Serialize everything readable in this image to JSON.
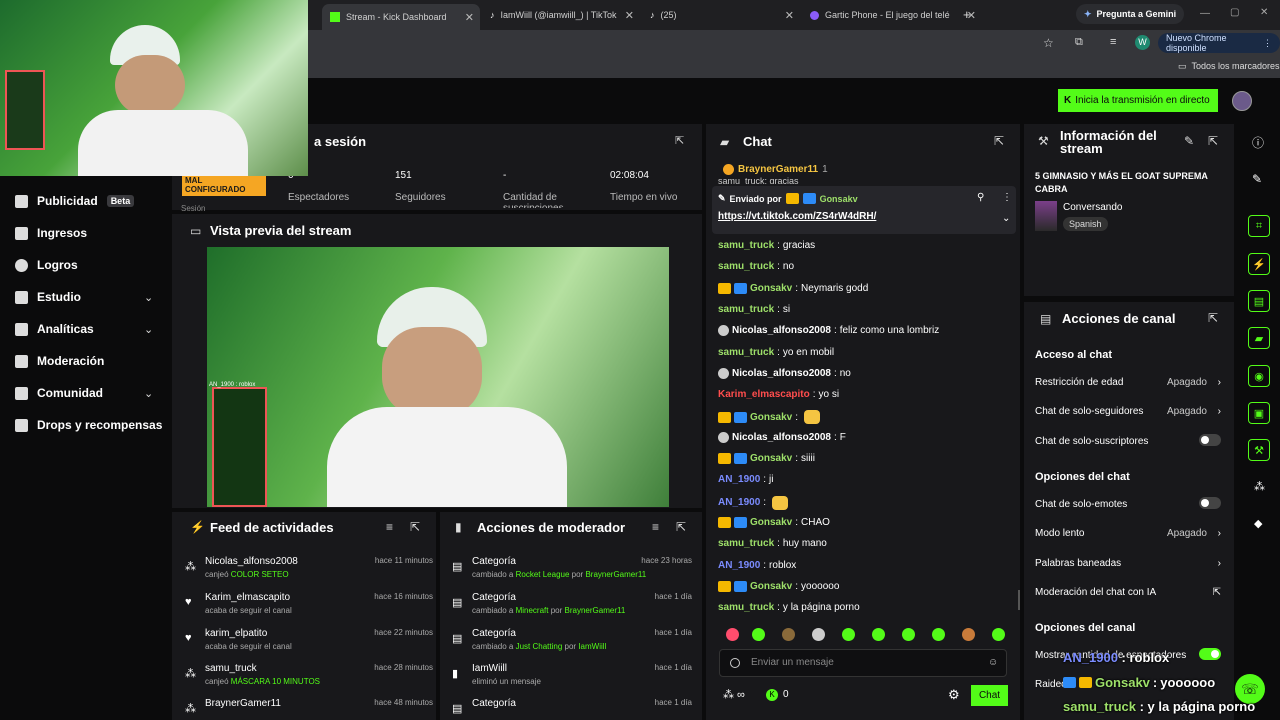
{
  "browser": {
    "tabs": [
      {
        "label": "Stream - Kick Dashboard"
      },
      {
        "label": "IamWiill (@iamwiill_) | TikTok"
      },
      {
        "label": "(25)"
      },
      {
        "label": "Gartic Phone - El juego del telé"
      }
    ],
    "gemini": "Pregunta a Gemini",
    "new_chrome": "Nuevo Chrome disponible",
    "bookmarks": "Todos los marcadores",
    "avatar_letter": "W"
  },
  "header": {
    "go_live": "Inicia la transmisión en directo"
  },
  "sidebar": {
    "items": [
      {
        "label": "Publicidad",
        "badge": "Beta"
      },
      {
        "label": "Ingresos"
      },
      {
        "label": "Logros"
      },
      {
        "label": "Estudio"
      },
      {
        "label": "Analíticas"
      },
      {
        "label": "Moderación"
      },
      {
        "label": "Comunidad"
      },
      {
        "label": "Drops y recompensas"
      }
    ]
  },
  "session": {
    "title": "a sesión",
    "warning": "MAL CONFIGURADO",
    "stats": [
      {
        "value": "0",
        "label": "Espectadores"
      },
      {
        "value": "151",
        "label": "Seguidores"
      },
      {
        "value": "-",
        "label": "Cantidad de suscripciones"
      },
      {
        "value": "02:08:04",
        "label": "Tiempo en vivo"
      }
    ],
    "cut_label": "Sesión"
  },
  "preview": {
    "title": "Vista previa del stream",
    "overlay": "AN_1900 : roblox"
  },
  "feed": {
    "title": "Feed de actividades",
    "items": [
      {
        "name": "Nicolas_alfonso2008",
        "pre": "canjeó ",
        "hl": "COLOR SETEO",
        "post": "",
        "time": "hace 11 minutos"
      },
      {
        "name": "Karim_elmascapito",
        "pre": "acaba de seguir el canal",
        "hl": "",
        "post": "",
        "time": "hace 16 minutos"
      },
      {
        "name": "karim_elpatito",
        "pre": "acaba de seguir el canal",
        "hl": "",
        "post": "",
        "time": "hace 22 minutos"
      },
      {
        "name": "samu_truck",
        "pre": "canjeó ",
        "hl": "MÁSCARA 10 MINUTOS",
        "post": "",
        "time": "hace 28 minutos"
      },
      {
        "name": "BraynerGamer11",
        "pre": "",
        "hl": "",
        "post": "",
        "time": "hace 48 minutos"
      }
    ]
  },
  "modactions": {
    "title": "Acciones de moderador",
    "items": [
      {
        "name": "Categoría",
        "pre": "cambiado a ",
        "cat": "Rocket League",
        "mid": " por ",
        "user": "BraynerGamer11",
        "time": "hace 23 horas"
      },
      {
        "name": "Categoría",
        "pre": "cambiado a ",
        "cat": "Minecraft",
        "mid": " por ",
        "user": "BraynerGamer11",
        "time": "hace 1 día"
      },
      {
        "name": "Categoría",
        "pre": "cambiado a ",
        "cat": "Just Chatting",
        "mid": " por ",
        "user": "IamWiill",
        "time": "hace 1 día"
      },
      {
        "name": "IamWiill",
        "pre": "eliminó un mensaje",
        "cat": "",
        "mid": "",
        "user": "",
        "time": "hace 1 día"
      },
      {
        "name": "Categoría",
        "pre": "",
        "cat": "",
        "mid": "",
        "user": "",
        "time": "hace 1 día"
      }
    ]
  },
  "chat": {
    "title": "Chat",
    "top_user": "BraynerGamer11",
    "top_count": "1",
    "top_cut": "samu_truck: gracias",
    "pinned_by_label": "Enviado por",
    "pinned_by": "Gonsakv",
    "pinned_link": "https://vt.tiktok.com/ZS4rW4dRH/",
    "messages": [
      {
        "user": "samu_truck",
        "text": "gracias",
        "color": "#9ee06a",
        "badges": ""
      },
      {
        "user": "samu_truck",
        "text": "no",
        "color": "#9ee06a",
        "badges": ""
      },
      {
        "user": "Gonsakv",
        "text": "Neymaris godd",
        "color": "#9ee06a",
        "badges": "cb"
      },
      {
        "user": "samu_truck",
        "text": "si",
        "color": "#9ee06a",
        "badges": ""
      },
      {
        "user": "Nicolas_alfonso2008",
        "text": "feliz como una lombriz",
        "color": "#ffffff",
        "badges": "w"
      },
      {
        "user": "samu_truck",
        "text": "yo en mobil",
        "color": "#9ee06a",
        "badges": ""
      },
      {
        "user": "Nicolas_alfonso2008",
        "text": "no",
        "color": "#ffffff",
        "badges": "w"
      },
      {
        "user": "Karim_elmascapito",
        "text": "yo si",
        "color": "#ff4d4d",
        "badges": ""
      },
      {
        "user": "Gonsakv",
        "text": "",
        "color": "#9ee06a",
        "badges": "cb"
      },
      {
        "user": "Nicolas_alfonso2008",
        "text": "F",
        "color": "#ffffff",
        "badges": "w"
      },
      {
        "user": "Gonsakv",
        "text": "siiii",
        "color": "#9ee06a",
        "badges": "cb"
      },
      {
        "user": "AN_1900",
        "text": "ji",
        "color": "#7b8cff",
        "badges": ""
      },
      {
        "user": "AN_1900",
        "text": "",
        "color": "#7b8cff",
        "badges": ""
      },
      {
        "user": "Gonsakv",
        "text": "CHAO",
        "color": "#9ee06a",
        "badges": "cb"
      },
      {
        "user": "samu_truck",
        "text": "huy mano",
        "color": "#9ee06a",
        "badges": ""
      },
      {
        "user": "AN_1900",
        "text": "roblox",
        "color": "#7b8cff",
        "badges": ""
      },
      {
        "user": "Gonsakv",
        "text": "yoooooo",
        "color": "#9ee06a",
        "badges": "cb"
      },
      {
        "user": "samu_truck",
        "text": "y la página porno",
        "color": "#9ee06a",
        "badges": ""
      }
    ],
    "placeholder": "Enviar un mensaje",
    "count": "0",
    "send": "Chat"
  },
  "info": {
    "title": "Información del stream",
    "stream_title": "5 GIMNASIO Y MÁS EL GOAT SUPREMA CABRA",
    "category": "Conversando",
    "language": "Spanish"
  },
  "channel": {
    "title": "Acciones de canal",
    "sections": [
      {
        "heading": "Acceso al chat",
        "rows": [
          {
            "label": "Restricción de edad",
            "value": "Apagado",
            "kind": "arrow"
          },
          {
            "label": "Chat de solo-seguidores",
            "value": "Apagado",
            "kind": "arrow"
          },
          {
            "label": "Chat de solo-suscriptores",
            "value": "",
            "kind": "toggle"
          }
        ]
      },
      {
        "heading": "Opciones del chat",
        "rows": [
          {
            "label": "Chat de solo-emotes",
            "value": "",
            "kind": "toggle"
          },
          {
            "label": "Modo lento",
            "value": "Apagado",
            "kind": "arrow"
          },
          {
            "label": "Palabras baneadas",
            "value": "",
            "kind": "arrow"
          },
          {
            "label": "Moderación del chat con IA",
            "value": "",
            "kind": "ext"
          }
        ]
      },
      {
        "heading": "Opciones del canal",
        "rows": [
          {
            "label": "Mostrar cantidad de espectadores",
            "value": "",
            "kind": "toggle-on"
          },
          {
            "label": "Raideo",
            "value": "",
            "kind": "none"
          }
        ]
      }
    ]
  },
  "overlay_chat": [
    {
      "user": "AN_1900",
      "text": "roblox"
    },
    {
      "user": "Gonsakv",
      "text": "yoooooo"
    },
    {
      "user": "samu_truck",
      "text": "y la página porno"
    }
  ],
  "colors": {
    "accent": "#53fc18",
    "panel": "#18181b",
    "bg": "#0b0b0c"
  }
}
